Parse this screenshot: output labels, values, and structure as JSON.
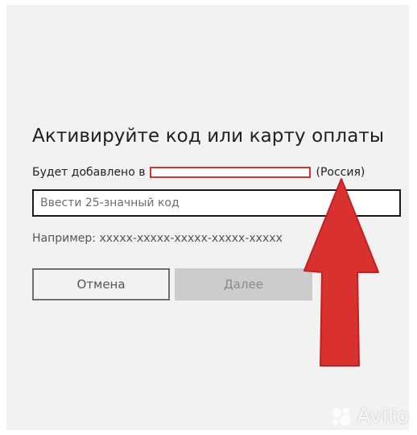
{
  "dialog": {
    "title": "Активируйте код или карту оплаты",
    "added_prefix": "Будет добавлено в",
    "country": "(Россия)",
    "code_input": {
      "value": "",
      "placeholder": "Ввести 25-значный код"
    },
    "example_text": "Например: xxxxx-xxxxx-xxxxx-xxxxx-xxxxx",
    "cancel_label": "Отмена",
    "next_label": "Далее"
  },
  "annotation": {
    "arrow_color": "#d93030",
    "redaction_color": "#d93030"
  },
  "watermark": {
    "text": "Avito"
  },
  "colors": {
    "dialog_bg": "#f2f2f2",
    "next_disabled_bg": "#cccccc"
  }
}
